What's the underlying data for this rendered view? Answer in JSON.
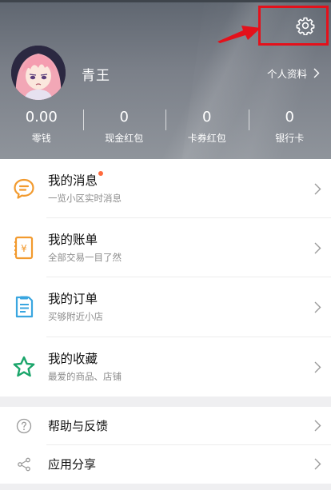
{
  "header": {
    "username": "青王",
    "profile_link": "个人资料",
    "stats": [
      {
        "value": "0.00",
        "label": "零钱"
      },
      {
        "value": "0",
        "label": "现金红包"
      },
      {
        "value": "0",
        "label": "卡券红包"
      },
      {
        "value": "0",
        "label": "银行卡"
      }
    ]
  },
  "menu": {
    "items": [
      {
        "title": "我的消息",
        "subtitle": "一览小区实时消息",
        "icon": "message-icon",
        "has_dot": true
      },
      {
        "title": "我的账单",
        "subtitle": "全部交易一目了然",
        "icon": "bill-icon"
      },
      {
        "title": "我的订单",
        "subtitle": "买够附近小店",
        "icon": "order-icon"
      },
      {
        "title": "我的收藏",
        "subtitle": "最爱的商品、店铺",
        "icon": "star-icon"
      }
    ]
  },
  "secondary_menu": {
    "items": [
      {
        "title": "帮助与反馈",
        "icon": "help-icon"
      },
      {
        "title": "应用分享",
        "icon": "share-icon"
      }
    ]
  },
  "colors": {
    "accent_orange": "#f29a2e",
    "dot_color": "#ff6a3d",
    "highlight_red": "#e4111b",
    "order_blue": "#3aa6e0",
    "star_green": "#1aa56a"
  }
}
